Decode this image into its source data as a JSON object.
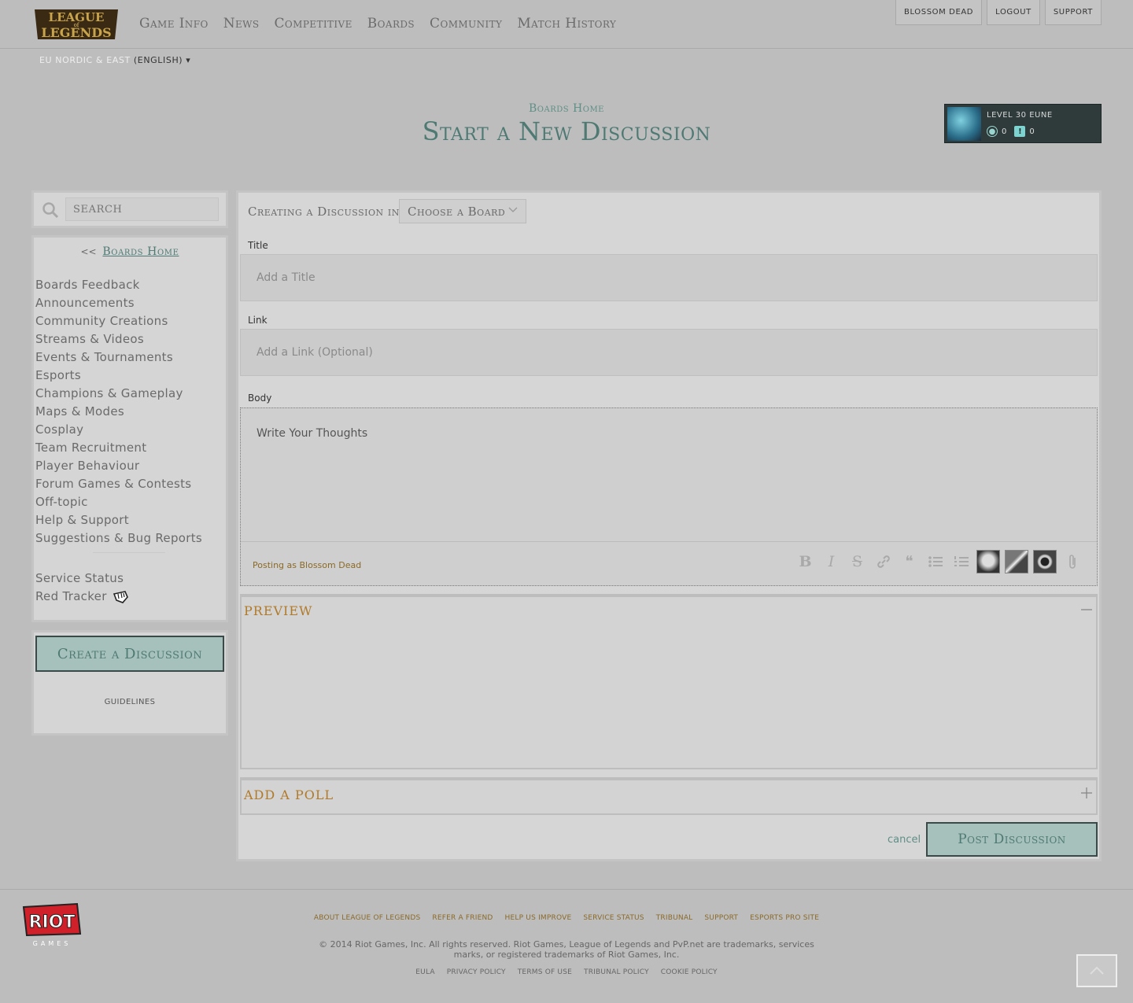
{
  "header": {
    "logo_text": [
      "LEAGUE",
      "of",
      "LEGENDS"
    ],
    "nav": [
      "Game Info",
      "News",
      "Competitive",
      "Boards",
      "Community",
      "Match History"
    ],
    "account": [
      "BLOSSOM DEAD",
      "LOGOUT",
      "SUPPORT"
    ],
    "region": "EU NORDIC & EAST",
    "language": "(ENGLISH) ▾"
  },
  "page": {
    "breadcrumb": "Boards Home",
    "title": "Start a New Discussion"
  },
  "profile": {
    "level": "LEVEL 30 EUNE",
    "count_a": "0",
    "count_b": "0"
  },
  "sidebar": {
    "search_placeholder": "SEARCH",
    "back_arrows": "<<",
    "boards_home": "Boards Home",
    "boards": [
      "Boards Feedback",
      "Announcements",
      "Community Creations",
      "Streams & Videos",
      "Events & Tournaments",
      "Esports",
      "Champions & Gameplay",
      "Maps & Modes",
      "Cosplay",
      "Team Recruitment",
      "Player Behaviour",
      "Forum Games & Contests",
      "Off-topic",
      "Help & Support",
      "Suggestions & Bug Reports"
    ],
    "extra": [
      "Service Status",
      "Red Tracker"
    ],
    "create_label": "Create a Discussion",
    "guidelines": "GUIDELINES"
  },
  "form": {
    "creating_in": "Creating a Discussion in",
    "board_select": "Choose a Board",
    "title_label": "Title",
    "title_placeholder": "Add a Title",
    "link_label": "Link",
    "link_placeholder": "Add a Link (Optional)",
    "body_label": "Body",
    "body_placeholder": "Write Your Thoughts",
    "posting_as": "Posting as Blossom Dead",
    "preview": "PREVIEW",
    "poll": "ADD A POLL",
    "cancel": "cancel",
    "post": "Post Discussion"
  },
  "footer": {
    "links": [
      "ABOUT LEAGUE OF LEGENDS",
      "REFER A FRIEND",
      "HELP US IMPROVE",
      "SERVICE STATUS",
      "TRIBUNAL",
      "SUPPORT",
      "ESPORTS PRO SITE"
    ],
    "copyright": "© 2014 Riot Games, Inc. All rights reserved. Riot Games, League of Legends and PvP.net are trademarks, services marks, or registered trademarks of Riot Games, Inc.",
    "legal": [
      "EULA",
      "PRIVACY POLICY",
      "TERMS OF USE",
      "TRIBUNAL POLICY",
      "COOKIE POLICY"
    ],
    "riot_logo_text": [
      "RIOT",
      "GAMES"
    ]
  },
  "colors": {
    "accent": "#4f7a74",
    "button_bg": "#a6c1bb",
    "section_title": "#b07a2a",
    "background": "#bdbdbd"
  }
}
